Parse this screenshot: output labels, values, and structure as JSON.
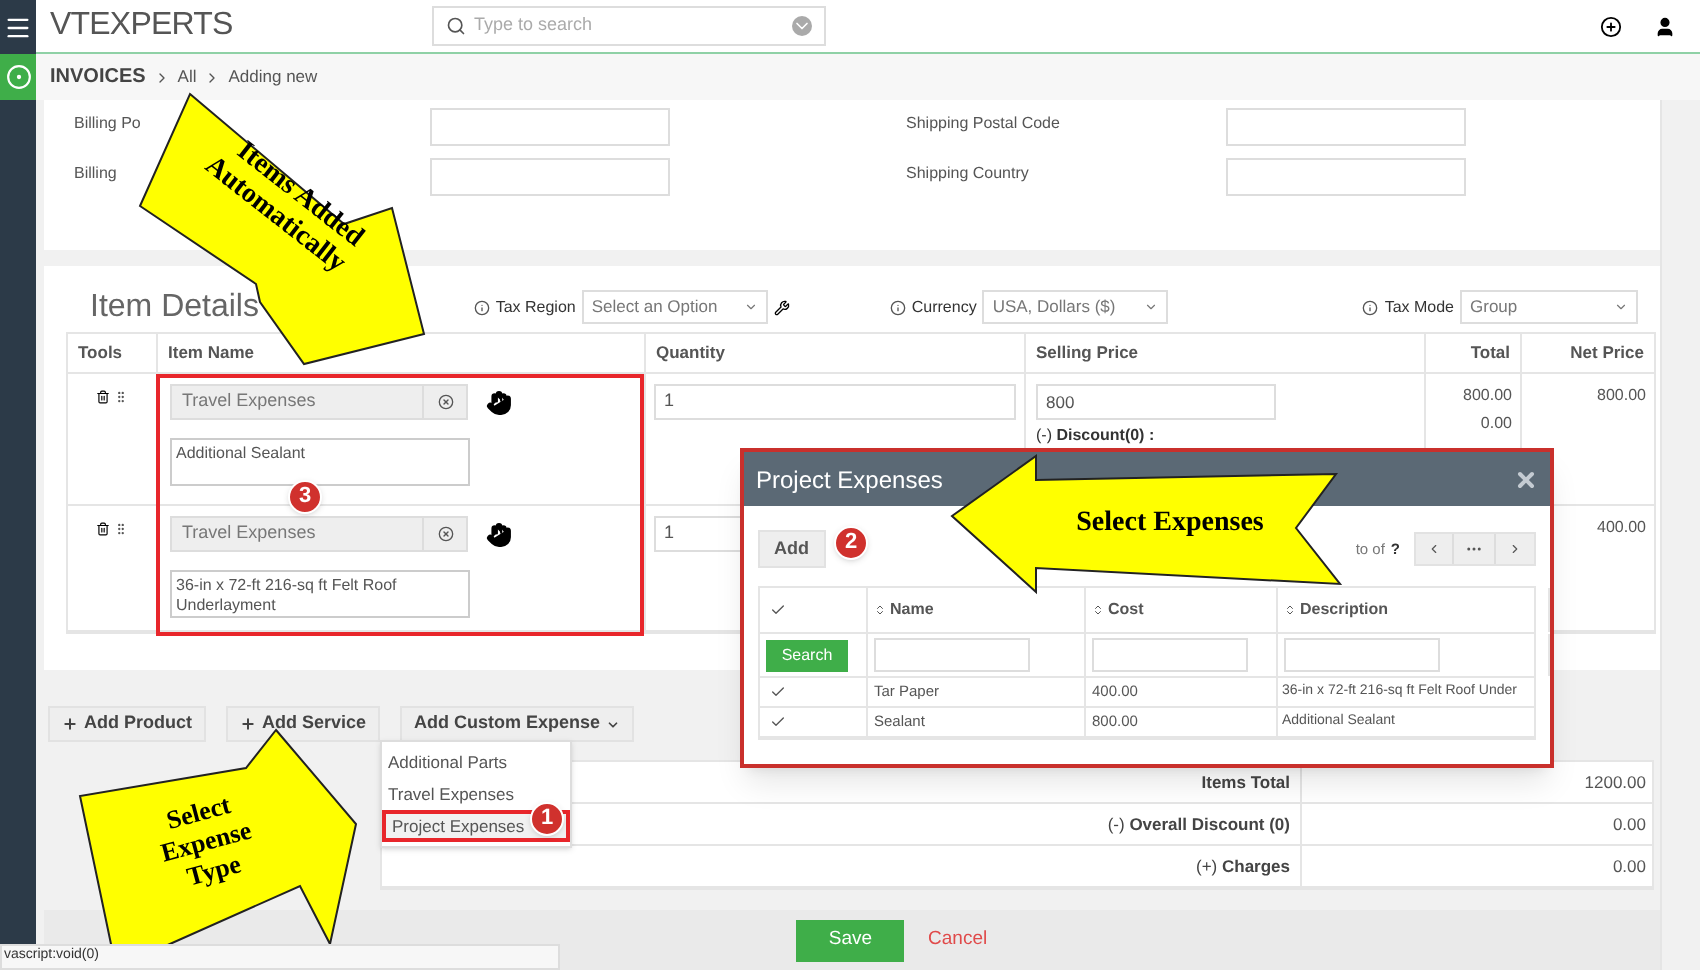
{
  "app": {
    "logo": "VTEXPERTS",
    "search": {
      "placeholder": "Type to search"
    }
  },
  "breadcrumb": [
    "INVOICES",
    "All",
    "Adding new"
  ],
  "address_fields": [
    {
      "label": "Billing Po"
    },
    {
      "label": "Shipping Postal Code"
    },
    {
      "label": "Billing"
    },
    {
      "label": "Shipping Country"
    }
  ],
  "item_details": {
    "title": "Item Details",
    "selectors": [
      {
        "label": "Tax Region",
        "value": "Select an Option"
      },
      {
        "label": "Currency",
        "value": "USA, Dollars ($)"
      },
      {
        "label": "Tax Mode",
        "value": "Group"
      }
    ],
    "columns": [
      "Tools",
      "Item Name",
      "Quantity",
      "Selling Price",
      "Total",
      "Net Price"
    ],
    "rows": [
      {
        "item": "Travel Expenses",
        "description": "Additional Sealant",
        "quantity": "1",
        "selling_price": "800",
        "discount": "(-) **Discount(0) :**",
        "totals": [
          "800.00",
          "0.00"
        ],
        "net_price": "800.00"
      },
      {
        "item": "Travel Expenses",
        "description": "36-in x 72-ft 216-sq ft Felt Roof Underlayment",
        "quantity": "1",
        "net_price": "400.00"
      }
    ]
  },
  "add_buttons": [
    {
      "label": "Add Product",
      "kind": "plus"
    },
    {
      "label": "Add Service",
      "kind": "plus"
    },
    {
      "label": "Add Custom Expense",
      "kind": "dropdown"
    }
  ],
  "expense_menu": [
    {
      "label": "Additional Parts",
      "selected": false
    },
    {
      "label": "Travel Expenses",
      "selected": false
    },
    {
      "label": "Project Expenses",
      "selected": true
    }
  ],
  "totals": [
    {
      "label": "Items Total",
      "value": "1200.00"
    },
    {
      "label": "(-) **Overall Discount (0)**",
      "value": "0.00"
    },
    {
      "label": "(+) **Charges**",
      "value": "0.00"
    }
  ],
  "modal": {
    "title": "Project Expenses",
    "add": "Add",
    "pager": "to of",
    "pager_total": "?",
    "header_checked": true,
    "columns": [
      "Name",
      "Cost",
      "Description"
    ],
    "search": "Search",
    "rows": [
      {
        "checked": true,
        "name": "Tar Paper",
        "cost": "400.00",
        "description": "36-in x 72-ft 216-sq ft Felt Roof Under"
      },
      {
        "checked": true,
        "name": "Sealant",
        "cost": "800.00",
        "description": "Additional Sealant"
      }
    ]
  },
  "footer": {
    "save": "Save",
    "cancel": "Cancel"
  },
  "status_bar": "vascript:void(0)",
  "callouts": [
    {
      "lines": [
        "Items Added",
        "Automatically"
      ]
    },
    {
      "lines": [
        "Select Expenses"
      ]
    },
    {
      "lines": [
        "Select",
        "Expense",
        "Type"
      ]
    }
  ],
  "step_badges": [
    "1",
    "2",
    "3"
  ]
}
